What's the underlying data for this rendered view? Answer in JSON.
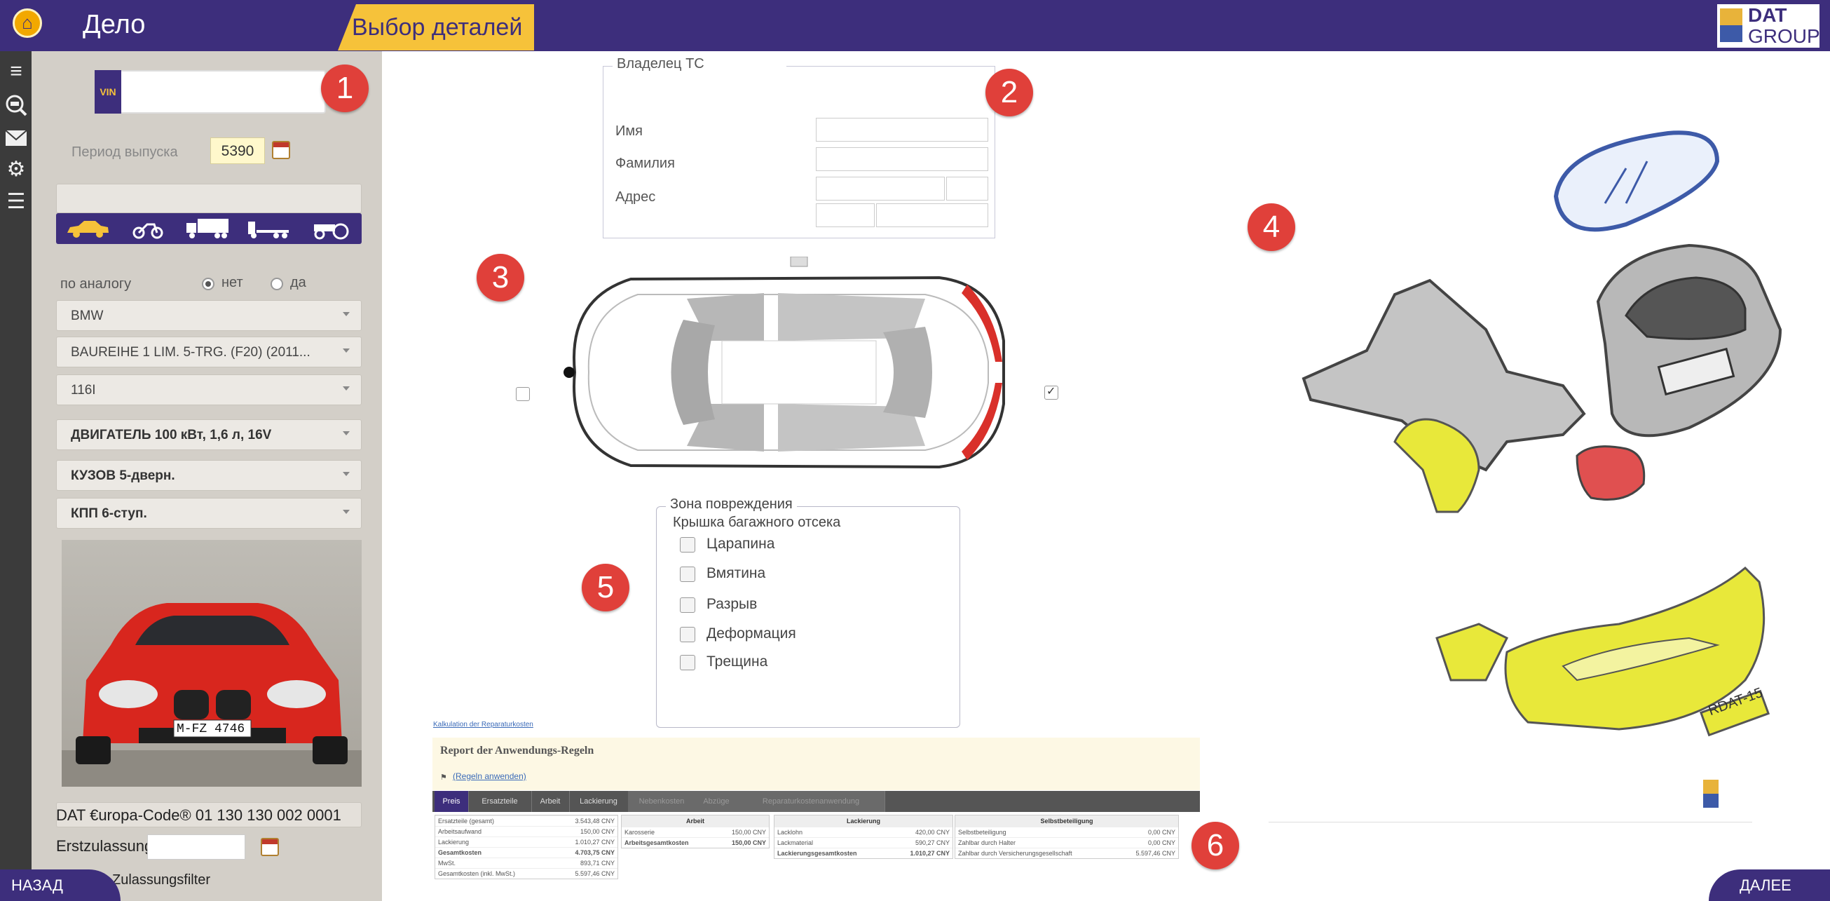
{
  "header": {
    "app_title": "Дело",
    "active_tab": "Выбор деталей",
    "logo_line1": "DAT",
    "logo_line2": "GROUP"
  },
  "sidebar": {
    "vin_label": "VIN",
    "vin_value": "",
    "period_label": "Период выпуска",
    "period_value": "5390",
    "analog_label": "по аналогу",
    "analog_options": [
      "нет",
      "да"
    ],
    "analog_selected": "нет",
    "selects": [
      {
        "value": "BMW"
      },
      {
        "value": "BAUREIHE 1 LIM. 5-TRG. (F20) (2011..."
      },
      {
        "value": "116I"
      },
      {
        "value": "ДВИГАТЕЛЬ 100 кВт, 1,6 л, 16V"
      },
      {
        "value": "КУЗОВ 5-дверн."
      },
      {
        "value": "КПП 6-ступ."
      }
    ],
    "plate": "M-FZ 4746",
    "europa_code": "DAT €uropa-Code® 01 130 130 002 0001",
    "erstzulassung_label": "Erstzulassung",
    "filter_label": "Zulassungsfilter"
  },
  "owner": {
    "legend": "Владелец ТС",
    "first_name_label": "Имя",
    "last_name_label": "Фамилия",
    "address_label": "Адрес"
  },
  "damage_zone": {
    "legend": "Зона повреждения",
    "zone_name": "Крышка багажного отсека",
    "options": [
      "Царапина",
      "Вмятина",
      "Разрыв",
      "Деформация",
      "Трещина"
    ]
  },
  "report": {
    "calc_link": "Kalkulation der Reparaturkosten",
    "title": "Report der Anwendungs-Regeln",
    "apply_link": "(Regeln anwenden)",
    "tabs": [
      "Preis",
      "Ersatzteile",
      "Arbeit",
      "Lackierung",
      "Nebenkosten",
      "Abzüge",
      "Reparaturkostenanwendung"
    ],
    "summary": [
      [
        "Ersatzteile (gesamt)",
        "3.543,48 CNY"
      ],
      [
        "Arbeitsaufwand",
        "150,00 CNY"
      ],
      [
        "Lackierung",
        "1.010,27 CNY"
      ],
      [
        "Gesamtkosten",
        "4.703,75 CNY"
      ],
      [
        "MwSt.",
        "893,71 CNY"
      ],
      [
        "Gesamtkosten (inkl. MwSt.)",
        "5.597,46 CNY"
      ]
    ],
    "arbeit": {
      "header": "Arbeit",
      "rows": [
        [
          "Karosserie",
          "150,00 CNY"
        ],
        [
          "Arbeitsgesamtkosten",
          "150,00 CNY"
        ]
      ]
    },
    "lackierung": {
      "header": "Lackierung",
      "rows": [
        [
          "Lacklohn",
          "420,00 CNY"
        ],
        [
          "Lackmaterial",
          "590,27 CNY"
        ],
        [
          "Lackierungsgesamtkosten",
          "1.010,27 CNY"
        ]
      ]
    },
    "selbst": {
      "header": "Selbstbeteiligung",
      "rows": [
        [
          "Selbstbeteiligung",
          "0,00 CNY"
        ],
        [
          "Zahlbar durch Halter",
          "0,00 CNY"
        ],
        [
          "Zahlbar durch Versicherungsgesellschaft",
          "5.597,46 CNY"
        ]
      ]
    }
  },
  "parts_plate": "RDAT-15",
  "badges": [
    "1",
    "2",
    "3",
    "4",
    "5",
    "6"
  ],
  "nav": {
    "back": "НАЗАД",
    "next": "ДАЛЕЕ"
  },
  "colors": {
    "primary": "#3d2e7c",
    "accent": "#f6c23a",
    "badge": "#e0403a",
    "highlight_part": "#e8e83a"
  }
}
